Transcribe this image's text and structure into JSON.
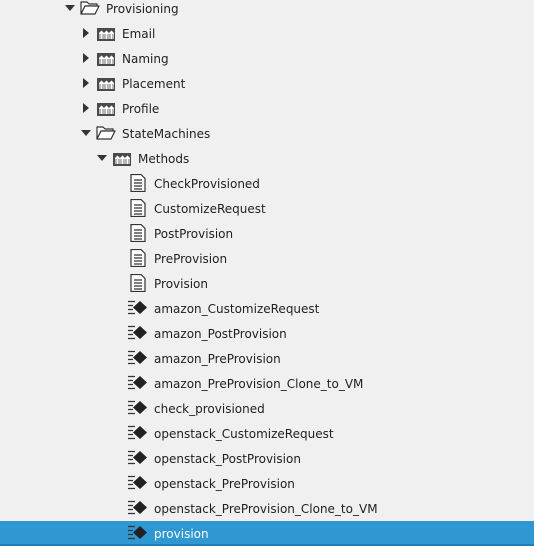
{
  "tree": {
    "nodes": [
      {
        "label": "Provisioning",
        "type": "folder",
        "level": 0,
        "toggle": "expanded"
      },
      {
        "label": "Email",
        "type": "namespace",
        "level": 1,
        "toggle": "collapsed"
      },
      {
        "label": "Naming",
        "type": "namespace",
        "level": 1,
        "toggle": "collapsed"
      },
      {
        "label": "Placement",
        "type": "namespace",
        "level": 1,
        "toggle": "collapsed"
      },
      {
        "label": "Profile",
        "type": "namespace",
        "level": 1,
        "toggle": "collapsed"
      },
      {
        "label": "StateMachines",
        "type": "folder",
        "level": 1,
        "toggle": "expanded"
      },
      {
        "label": "Methods",
        "type": "namespace",
        "level": 2,
        "toggle": "expanded"
      },
      {
        "label": "CheckProvisioned",
        "type": "instance",
        "level": 3,
        "toggle": "none"
      },
      {
        "label": "CustomizeRequest",
        "type": "instance",
        "level": 3,
        "toggle": "none"
      },
      {
        "label": "PostProvision",
        "type": "instance",
        "level": 3,
        "toggle": "none"
      },
      {
        "label": "PreProvision",
        "type": "instance",
        "level": 3,
        "toggle": "none"
      },
      {
        "label": "Provision",
        "type": "instance",
        "level": 3,
        "toggle": "none"
      },
      {
        "label": "amazon_CustomizeRequest",
        "type": "method",
        "level": 3,
        "toggle": "none"
      },
      {
        "label": "amazon_PostProvision",
        "type": "method",
        "level": 3,
        "toggle": "none"
      },
      {
        "label": "amazon_PreProvision",
        "type": "method",
        "level": 3,
        "toggle": "none"
      },
      {
        "label": "amazon_PreProvision_Clone_to_VM",
        "type": "method",
        "level": 3,
        "toggle": "none"
      },
      {
        "label": "check_provisioned",
        "type": "method",
        "level": 3,
        "toggle": "none"
      },
      {
        "label": "openstack_CustomizeRequest",
        "type": "method",
        "level": 3,
        "toggle": "none"
      },
      {
        "label": "openstack_PostProvision",
        "type": "method",
        "level": 3,
        "toggle": "none"
      },
      {
        "label": "openstack_PreProvision",
        "type": "method",
        "level": 3,
        "toggle": "none"
      },
      {
        "label": "openstack_PreProvision_Clone_to_VM",
        "type": "method",
        "level": 3,
        "toggle": "none"
      },
      {
        "label": "provision",
        "type": "method",
        "level": 3,
        "toggle": "none",
        "selected": true
      }
    ]
  },
  "icon_names": {
    "folder": "folder-open-icon",
    "namespace": "namespace-icon",
    "instance": "document-icon",
    "method": "method-icon"
  },
  "colors": {
    "selection": "#2f98d2",
    "background": "#f0f0f0"
  }
}
